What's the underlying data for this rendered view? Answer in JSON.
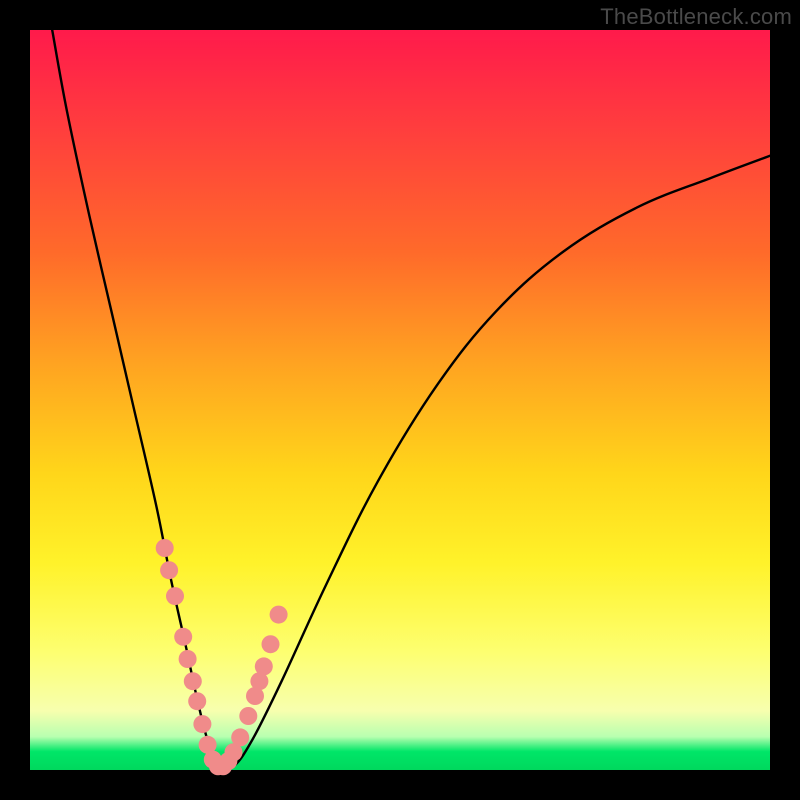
{
  "watermark": "TheBottleneck.com",
  "chart_data": {
    "type": "line",
    "title": "",
    "xlabel": "",
    "ylabel": "",
    "xlim": [
      0,
      100
    ],
    "ylim": [
      0,
      100
    ],
    "series": [
      {
        "name": "bottleneck-curve",
        "x": [
          3,
          5,
          8,
          11,
          14,
          17,
          19,
          21,
          22.5,
          24,
          25.5,
          27.5,
          30,
          34,
          40,
          47,
          55,
          63,
          72,
          82,
          92,
          100
        ],
        "values": [
          100,
          89,
          75,
          62,
          49,
          36,
          26,
          17,
          10,
          4,
          0.5,
          0.5,
          4,
          12,
          25,
          39,
          52,
          62,
          70,
          76,
          80,
          83
        ]
      }
    ],
    "markers": {
      "name": "highlighted-points",
      "color": "#f08b8a",
      "x": [
        18.2,
        18.8,
        19.6,
        20.7,
        21.3,
        22.0,
        22.6,
        23.3,
        24.0,
        24.7,
        25.4,
        26.1,
        26.8,
        27.5,
        28.4,
        29.5,
        30.4,
        31.0,
        31.6,
        32.5,
        33.6
      ],
      "values": [
        30.0,
        27.0,
        23.5,
        18.0,
        15.0,
        12.0,
        9.3,
        6.2,
        3.4,
        1.4,
        0.5,
        0.5,
        1.2,
        2.4,
        4.4,
        7.3,
        10.0,
        12.0,
        14.0,
        17.0,
        21.0
      ]
    }
  }
}
